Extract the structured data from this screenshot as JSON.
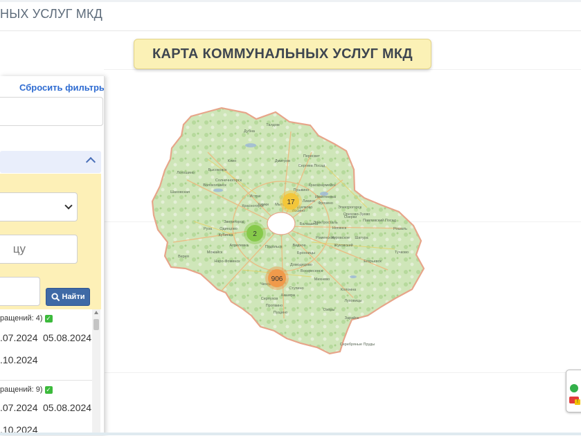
{
  "header": {
    "title": "НЫХ УСЛУГ МКД"
  },
  "banner": {
    "title": "КАРТА КОММУНАЛЬНЫХ УСЛУГ МКД"
  },
  "filters": {
    "reset_label": "Сбросить фильтры",
    "street_placeholder": "цу",
    "find_label": "Найти",
    "icons": {
      "search": "search-icon",
      "collapse": "chevron-up-icon",
      "select": "chevron-down-icon"
    },
    "colors": {
      "panel_bg": "#fdf0b7",
      "accent": "#2e6bd1",
      "button": "#3f6aa6"
    }
  },
  "results": [
    {
      "header": "ращений: 4)",
      "date_a": ".07.2024",
      "date_b": "05.08.2024",
      "date_c": ".10.2024"
    },
    {
      "header": "ращений: 9)",
      "date_a": ".07.2024",
      "date_b": "05.08.2024",
      "date_c": ".10.2024"
    }
  ],
  "map": {
    "clusters": [
      {
        "label": "17",
        "color": "#f3c63a"
      },
      {
        "label": "2",
        "color": "#86c94a"
      },
      {
        "label": "906",
        "color": "#f09a4b"
      }
    ],
    "places": [
      {
        "name": "Талдом"
      },
      {
        "name": "Дубна"
      },
      {
        "name": "Дмитров"
      },
      {
        "name": "Клин"
      },
      {
        "name": "Сергиев Посад"
      },
      {
        "name": "Пересвет"
      },
      {
        "name": "Солнечногорск"
      },
      {
        "name": "Высоковск"
      },
      {
        "name": "Лотошино"
      },
      {
        "name": "Волоколамск"
      },
      {
        "name": "Шаховская"
      },
      {
        "name": "Истра"
      },
      {
        "name": "Красногорск"
      },
      {
        "name": "Химки"
      },
      {
        "name": "Мытищи"
      },
      {
        "name": "Пушкино"
      },
      {
        "name": "Красноармейск"
      },
      {
        "name": "Ивантеевка"
      },
      {
        "name": "Щелково"
      },
      {
        "name": "Фрязино"
      },
      {
        "name": "Электрогорск"
      },
      {
        "name": "Орехово-Зуево"
      },
      {
        "name": "Павловский Посад"
      },
      {
        "name": "Рошаль"
      },
      {
        "name": "Балашиха"
      },
      {
        "name": "Электросталь"
      },
      {
        "name": "Ногинск"
      },
      {
        "name": "Звенигород"
      },
      {
        "name": "Руза"
      },
      {
        "name": "Кубинка"
      },
      {
        "name": "Одинцово"
      },
      {
        "name": "Апрелевка"
      },
      {
        "name": "Можайск"
      },
      {
        "name": "Наро-Фоминск"
      },
      {
        "name": "Верея"
      },
      {
        "name": "Подольск"
      },
      {
        "name": "Видное"
      },
      {
        "name": "Бронницы"
      },
      {
        "name": "Раменское"
      },
      {
        "name": "Жуковский"
      },
      {
        "name": "Куровское"
      },
      {
        "name": "Шатура"
      },
      {
        "name": "Егорьевск"
      },
      {
        "name": "Тучково"
      },
      {
        "name": "Воскресенск"
      },
      {
        "name": "Домодедово"
      },
      {
        "name": "Михнево"
      },
      {
        "name": "Коломна"
      },
      {
        "name": "Луховицы"
      },
      {
        "name": "Ступино"
      },
      {
        "name": "Серпухов"
      },
      {
        "name": "Протвино"
      },
      {
        "name": "Кашира"
      },
      {
        "name": "Озёры"
      },
      {
        "name": "Зарайск"
      },
      {
        "name": "Пущино"
      },
      {
        "name": "Серебряные Пруды"
      },
      {
        "name": "Чехов"
      },
      {
        "name": "Лосино"
      },
      {
        "name": "Ликино"
      },
      {
        "name": "Озерки"
      }
    ]
  },
  "legend": {
    "icons": [
      "status-green-icon",
      "warning-flag-icon"
    ],
    "colors": {
      "green": "#33b04a",
      "red": "#e23b3b"
    }
  }
}
